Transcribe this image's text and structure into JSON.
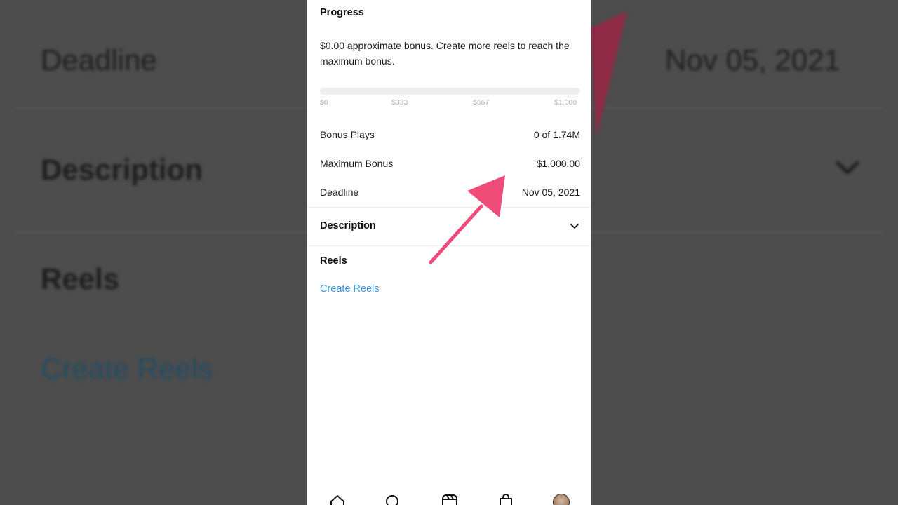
{
  "background": {
    "deadline_label": "Deadline",
    "deadline_value": "Nov 05, 2021",
    "description_label": "Description",
    "reels_label": "Reels",
    "create_reels": "Create Reels"
  },
  "progress": {
    "heading": "Progress",
    "message": "$0.00 approximate bonus. Create more reels to reach the maximum bonus.",
    "fill_fraction": 0,
    "ticks": [
      "$0",
      "$333",
      "$667",
      "$1,000"
    ]
  },
  "stats": {
    "bonus_plays": {
      "label": "Bonus Plays",
      "value": "0 of 1.74M"
    },
    "maximum_bonus": {
      "label": "Maximum Bonus",
      "value": "$1,000.00"
    },
    "deadline": {
      "label": "Deadline",
      "value": "Nov 05, 2021"
    }
  },
  "description": {
    "heading": "Description",
    "icon": "chevron-down-icon"
  },
  "reels": {
    "heading": "Reels",
    "create_link": "Create Reels"
  },
  "nav": {
    "items": [
      "home-icon",
      "search-icon",
      "reels-icon",
      "shop-icon",
      "profile-avatar"
    ]
  },
  "colors": {
    "link": "#3b97e3",
    "annotation_arrow": "#ef4b78",
    "progress_track": "#eeeff2"
  }
}
